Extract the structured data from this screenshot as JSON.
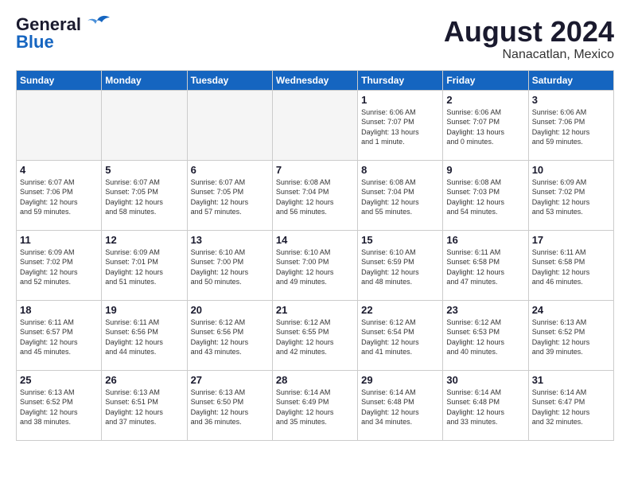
{
  "header": {
    "logo_line1": "General",
    "logo_line2": "Blue",
    "month_year": "August 2024",
    "location": "Nanacatlan, Mexico"
  },
  "days_of_week": [
    "Sunday",
    "Monday",
    "Tuesday",
    "Wednesday",
    "Thursday",
    "Friday",
    "Saturday"
  ],
  "weeks": [
    [
      {
        "day": "",
        "info": ""
      },
      {
        "day": "",
        "info": ""
      },
      {
        "day": "",
        "info": ""
      },
      {
        "day": "",
        "info": ""
      },
      {
        "day": "1",
        "info": "Sunrise: 6:06 AM\nSunset: 7:07 PM\nDaylight: 13 hours\nand 1 minute."
      },
      {
        "day": "2",
        "info": "Sunrise: 6:06 AM\nSunset: 7:07 PM\nDaylight: 13 hours\nand 0 minutes."
      },
      {
        "day": "3",
        "info": "Sunrise: 6:06 AM\nSunset: 7:06 PM\nDaylight: 12 hours\nand 59 minutes."
      }
    ],
    [
      {
        "day": "4",
        "info": "Sunrise: 6:07 AM\nSunset: 7:06 PM\nDaylight: 12 hours\nand 59 minutes."
      },
      {
        "day": "5",
        "info": "Sunrise: 6:07 AM\nSunset: 7:05 PM\nDaylight: 12 hours\nand 58 minutes."
      },
      {
        "day": "6",
        "info": "Sunrise: 6:07 AM\nSunset: 7:05 PM\nDaylight: 12 hours\nand 57 minutes."
      },
      {
        "day": "7",
        "info": "Sunrise: 6:08 AM\nSunset: 7:04 PM\nDaylight: 12 hours\nand 56 minutes."
      },
      {
        "day": "8",
        "info": "Sunrise: 6:08 AM\nSunset: 7:04 PM\nDaylight: 12 hours\nand 55 minutes."
      },
      {
        "day": "9",
        "info": "Sunrise: 6:08 AM\nSunset: 7:03 PM\nDaylight: 12 hours\nand 54 minutes."
      },
      {
        "day": "10",
        "info": "Sunrise: 6:09 AM\nSunset: 7:02 PM\nDaylight: 12 hours\nand 53 minutes."
      }
    ],
    [
      {
        "day": "11",
        "info": "Sunrise: 6:09 AM\nSunset: 7:02 PM\nDaylight: 12 hours\nand 52 minutes."
      },
      {
        "day": "12",
        "info": "Sunrise: 6:09 AM\nSunset: 7:01 PM\nDaylight: 12 hours\nand 51 minutes."
      },
      {
        "day": "13",
        "info": "Sunrise: 6:10 AM\nSunset: 7:00 PM\nDaylight: 12 hours\nand 50 minutes."
      },
      {
        "day": "14",
        "info": "Sunrise: 6:10 AM\nSunset: 7:00 PM\nDaylight: 12 hours\nand 49 minutes."
      },
      {
        "day": "15",
        "info": "Sunrise: 6:10 AM\nSunset: 6:59 PM\nDaylight: 12 hours\nand 48 minutes."
      },
      {
        "day": "16",
        "info": "Sunrise: 6:11 AM\nSunset: 6:58 PM\nDaylight: 12 hours\nand 47 minutes."
      },
      {
        "day": "17",
        "info": "Sunrise: 6:11 AM\nSunset: 6:58 PM\nDaylight: 12 hours\nand 46 minutes."
      }
    ],
    [
      {
        "day": "18",
        "info": "Sunrise: 6:11 AM\nSunset: 6:57 PM\nDaylight: 12 hours\nand 45 minutes."
      },
      {
        "day": "19",
        "info": "Sunrise: 6:11 AM\nSunset: 6:56 PM\nDaylight: 12 hours\nand 44 minutes."
      },
      {
        "day": "20",
        "info": "Sunrise: 6:12 AM\nSunset: 6:56 PM\nDaylight: 12 hours\nand 43 minutes."
      },
      {
        "day": "21",
        "info": "Sunrise: 6:12 AM\nSunset: 6:55 PM\nDaylight: 12 hours\nand 42 minutes."
      },
      {
        "day": "22",
        "info": "Sunrise: 6:12 AM\nSunset: 6:54 PM\nDaylight: 12 hours\nand 41 minutes."
      },
      {
        "day": "23",
        "info": "Sunrise: 6:12 AM\nSunset: 6:53 PM\nDaylight: 12 hours\nand 40 minutes."
      },
      {
        "day": "24",
        "info": "Sunrise: 6:13 AM\nSunset: 6:52 PM\nDaylight: 12 hours\nand 39 minutes."
      }
    ],
    [
      {
        "day": "25",
        "info": "Sunrise: 6:13 AM\nSunset: 6:52 PM\nDaylight: 12 hours\nand 38 minutes."
      },
      {
        "day": "26",
        "info": "Sunrise: 6:13 AM\nSunset: 6:51 PM\nDaylight: 12 hours\nand 37 minutes."
      },
      {
        "day": "27",
        "info": "Sunrise: 6:13 AM\nSunset: 6:50 PM\nDaylight: 12 hours\nand 36 minutes."
      },
      {
        "day": "28",
        "info": "Sunrise: 6:14 AM\nSunset: 6:49 PM\nDaylight: 12 hours\nand 35 minutes."
      },
      {
        "day": "29",
        "info": "Sunrise: 6:14 AM\nSunset: 6:48 PM\nDaylight: 12 hours\nand 34 minutes."
      },
      {
        "day": "30",
        "info": "Sunrise: 6:14 AM\nSunset: 6:48 PM\nDaylight: 12 hours\nand 33 minutes."
      },
      {
        "day": "31",
        "info": "Sunrise: 6:14 AM\nSunset: 6:47 PM\nDaylight: 12 hours\nand 32 minutes."
      }
    ]
  ]
}
